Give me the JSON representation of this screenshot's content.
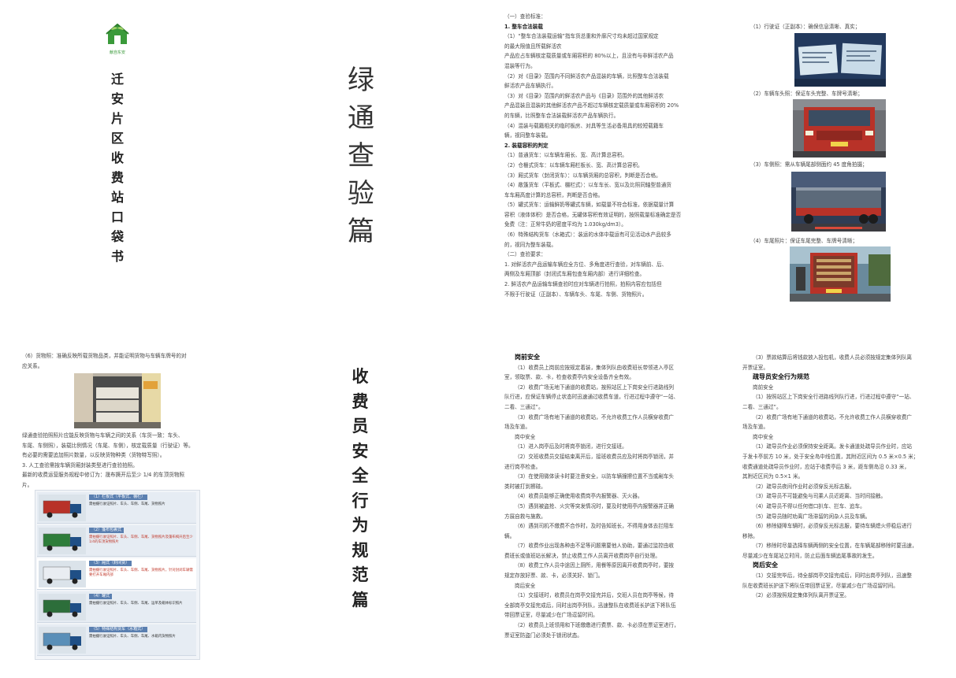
{
  "cover": {
    "logo_text": "献自东安",
    "title_chars": [
      "迁",
      "安",
      "片",
      "区",
      "收",
      "费",
      "站",
      "口",
      "袋",
      "书"
    ]
  },
  "section1": {
    "title_chars": [
      "绿",
      "通",
      "查",
      "验",
      "篇"
    ]
  },
  "section2": {
    "title_chars": [
      "收",
      "费",
      "员",
      "安",
      "全",
      "行",
      "为",
      "规",
      "范",
      "篇"
    ]
  },
  "page_green_standards": {
    "lines": [
      "（一）查验标准：",
      "1. 整车合法装载",
      "（1）“整车合法装载运输”指车货总重和外廓尺寸均未超过国家规定",
      "的最大限值且所载鲜活农",
      "产品应占车辆核定载质量或车厢容积的 80%以上，且没有与非鲜活农产品",
      "混装等行为。",
      "（2）对《目录》范围内不同鲜活农产品混装的车辆，比照整车合法装载",
      "鲜活农产品车辆执行。",
      "（3）对《目录》范围内的鲜活农产品与《目录》范围外的其他鲜活农",
      "产品混装且混装的其他鲜活农产品不超过车辆核定载质量或车厢容积的 20%",
      "的车辆，比照整车合法装载鲜活农产品车辆执行。",
      "（4）混装与载籍相关的临时板房、对具等生活必备用具的较短载籍车",
      "辆，视同整车装载。",
      "2. 装载容积的判定",
      "（1）普通货车：以车辆车厢长、宽、高计算总容积。",
      "（2）仓栅式货车：以车辆车厢栏板长、宽、高计算总容积。",
      "（3）厢式货车（封闭货车）：以车辆货厢的总容积，判断是否合格。",
      "（4）敞篷货车（平板式、棚栏式）：以车车长、宽以及比照同轴型普通货",
      "车车厢高度计算的总容积，判断是否合格。",
      "（5）罐式货车：运输鲜奶等罐式车辆，如载量不符合标准，依据载量计算",
      "容积（液体体积）是否合格，无罐体容积有效证明的，按照载量标准确定是否",
      "免费（注：正常牛奶的密度平均为 1.030kg/dm3）。",
      "（6）特殊结构货车（水箱式）：装运的水体中载运有可见活动水产品较多",
      "的，视同为整车装载。",
      "（二）查验要求：",
      "1. 对鲜活农产品运输车辆应全方位、多角度进行查验，对车辆前、后、",
      "两侧及车厢顶部（封闭式车厢包查车厢内部）进行详细检查。",
      "2. 鲜活农产品运输车辆查验时应对车辆进行拍照，拍照内容应包括但",
      "不限于行驶证（正副本）、车辆车头、车尾、车侧、货物照片。"
    ]
  },
  "page_photos": {
    "items": [
      "（1）行驶证（正副本）：确保信息清晰、真实；",
      "（2）车辆车头照：保证车头完整、车牌号清晰；",
      "（3）车侧照：需从车辆尾部侧面约 45 度角拍摄；",
      "（4）车尾照片：保证车尾完整、车牌号清晰；"
    ]
  },
  "page_cargo": {
    "lines_top": [
      "（6）货物照：准确反映所载货物品类，并能证明货物与车辆车牌号的对",
      "应关系。"
    ],
    "lines_mid": [
      "绿通查验拍照照片应能反映货物与车辆之间的关系（车货一致：车头、",
      "车尾、车侧照），装载比例情况（车尾、车侧），核定载质量（行驶证）等。",
      "有必要的需要追加照片数量，以反映货物种类（货物特写照）。",
      "3. 人工查验需按车辆货厢封装类型进行查验拍照。",
      "最新的收费运营服务规程中修订为：晟布撅开后至少 1/4 的车顶货物照",
      "片。"
    ],
    "infographic": [
      {
        "head": "（1）栏板式（平板式、棚栏）",
        "text": "需拍摄行驶证照片、车头、车侧、车尾、货物照片"
      },
      {
        "head": "（2）篷布包裹式",
        "text": "需拍摄行驶证照片、车头、车侧、车尾、货物照片及篷布揭开后至少1/4的车顶货物照片"
      },
      {
        "head": "（3）厢式（封闭货）",
        "text": "需拍摄行驶证照片、车头、车侧、车尾、货物照片，针对封闭车辆需要打开车厢内部"
      },
      {
        "head": "（4）罐式",
        "text": "需拍摄行驶证照片、车头、车侧、车尾、运单及箱体标识照片"
      },
      {
        "head": "（5）特殊结构货车（水箱式）",
        "text": "需拍摄行驶证照片、车头、车侧、车尾、水箱内货物照片"
      }
    ]
  },
  "page_safety1": {
    "lines": [
      {
        "t": "岗前安全",
        "c": "h"
      },
      {
        "t": "（1）收费员上岗前应按规定着装，集体列队由收费班长带领进入亭区",
        "c": "ind"
      },
      {
        "t": "室，领取票、款、卡，检查收费亭内安全设备齐全有效。",
        "c": ""
      },
      {
        "t": "（2）收费广场无地下通道的收费站，按照站区上下岗安全行进路线列",
        "c": "ind"
      },
      {
        "t": "队行进，应保证车辆停止状态时迅速通过收费车道，行进过程中遵守“一站、",
        "c": ""
      },
      {
        "t": "二看、三通过”。",
        "c": ""
      },
      {
        "t": "（3）收费广场有地下通道的收费站，不允许收费工作人员横穿收费广",
        "c": "ind"
      },
      {
        "t": "场及车道。",
        "c": ""
      },
      {
        "t": "岗中安全",
        "c": "ind"
      },
      {
        "t": "（1）进入岗亭后及时将岗亭锁闭，进行交接班。",
        "c": "ind"
      },
      {
        "t": "（2）交班收费员交接结束离开后，接班收费员应及时将岗亭锁闭，并",
        "c": "ind"
      },
      {
        "t": "进行岗亭检查。",
        "c": ""
      },
      {
        "t": "（3）在使用微体读卡时要注意安全，以防车辆撞擦位置不当或剐车头",
        "c": "ind"
      },
      {
        "t": "类时被打到擦碰。",
        "c": ""
      },
      {
        "t": "（4）收费员能够正确使用收费岗亭内报警器、灭火器。",
        "c": "ind"
      },
      {
        "t": "（5）遇到被盗抢、火灾等突发情况时，要及时使用亭内报警器并正确",
        "c": "ind"
      },
      {
        "t": "方展自救与施救。",
        "c": ""
      },
      {
        "t": "（6）遇到司机不缴费不合作时，及时告知班长，不得用身体去拦阻车",
        "c": "ind"
      },
      {
        "t": "辆。",
        "c": ""
      },
      {
        "t": "（7）收费作业出现各种由不足等问题需要他人协助，要通过监控由收",
        "c": "ind"
      },
      {
        "t": "费班长或值班站长解决，禁止收费工作人员离开收费岗亭自行处理。",
        "c": ""
      },
      {
        "t": "（8）收费工作人员中途因上厕所，用餐等原因离开收费岗亭时，要按",
        "c": "ind"
      },
      {
        "t": "规定存放好票、款、卡，必须关好、锁门。",
        "c": ""
      },
      {
        "t": "岗后安全",
        "c": "ind"
      },
      {
        "t": "（1）交接班时，收费员在岗亭交接完并后，交班人员在岗亭等候，待",
        "c": "ind"
      },
      {
        "t": "全部岗亭交接完成后，同时出岗亭列队，迅速整队在收费班长护送下将队伍",
        "c": ""
      },
      {
        "t": "带回票证室，尽量减少在广场逗留时间。",
        "c": ""
      },
      {
        "t": "（2）收费员上班领用和下班缴缴进行费票、款、卡必须在票证室进行，",
        "c": "ind"
      },
      {
        "t": "票证室防盗门必须处于锁闭状态。",
        "c": ""
      }
    ]
  },
  "page_safety2": {
    "lines": [
      {
        "t": "（3）票款结算后将钱款放入投包机，收费人员必须按规定集体列队离",
        "c": "ind"
      },
      {
        "t": "开票证室。",
        "c": ""
      },
      {
        "t": "疏导员安全行为规范",
        "c": "h"
      },
      {
        "t": "岗前安全",
        "c": "ind"
      },
      {
        "t": "（1）按照站区上下岗安全行进路线列队行进，行进过程中遵守“一站、",
        "c": "ind"
      },
      {
        "t": "二看、三通过”。",
        "c": ""
      },
      {
        "t": "（2）收费广场有地下通道的收费站，不允许收费工作人员横穿收费广",
        "c": "ind"
      },
      {
        "t": "场及车道。",
        "c": ""
      },
      {
        "t": "岗中安全",
        "c": "ind"
      },
      {
        "t": "（1）疏导员作业必须保持安全距离。发卡通道处疏导员作业时，应站",
        "c": "ind"
      },
      {
        "t": "于发卡亭前方 10 米，处于安全岛中线位置，其附近区间为 0.5 米×0.5 米；",
        "c": ""
      },
      {
        "t": "收费通道处疏导员作业时，应站于收费亭后 3 米，距车侧岛沿 0.33 米，",
        "c": ""
      },
      {
        "t": "其附近区间为 0.5×1 米。",
        "c": ""
      },
      {
        "t": "（2）疏导员夜间作业时必须穿反光标志服。",
        "c": "ind"
      },
      {
        "t": "（3）疏导员不可能避免与司乘人员近距离、当时间接触。",
        "c": "ind"
      },
      {
        "t": "（4）疏导员不得以任何借口扒车、拦车、追车。",
        "c": "ind"
      },
      {
        "t": "（5）疏导员随时劝离广场滞留的闲杂人员及车辆。",
        "c": "ind"
      },
      {
        "t": "（6）移除疑障车辆时，必须穿反光标志服，要待车辆熄火停稳后进行",
        "c": "ind"
      },
      {
        "t": "移除。",
        "c": ""
      },
      {
        "t": "（7）移除时尽量选择车辆两侧的安全位置，在车辆尾部移除时要迅速，",
        "c": "ind"
      },
      {
        "t": "尽量减少在车尾站立时间，防止后面车辆追尾事故的发生。",
        "c": ""
      },
      {
        "t": "岗后安全",
        "c": "h"
      },
      {
        "t": "（1）交接完毕后，待全部岗亭交接完成后，同时出岗亭列队，迅速整",
        "c": "ind"
      },
      {
        "t": "队在收费班长护送下将队伍带回票证室，尽量减少在广场逗留时间。",
        "c": ""
      },
      {
        "t": "（2）必须按照规定集体列队离开票证室。",
        "c": "ind"
      }
    ]
  },
  "colors": {
    "logo_green": "#3a9a3a",
    "title_dark": "#222222",
    "photo_blue": "#1d5aa8",
    "truck_red": "#b83228"
  }
}
